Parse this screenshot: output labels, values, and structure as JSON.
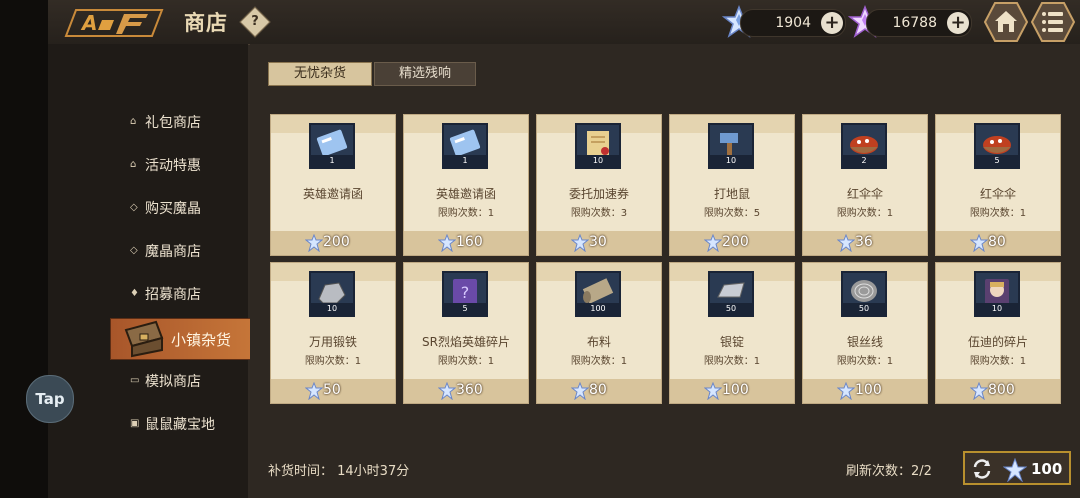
{
  "header": {
    "title": "商店",
    "help_label": "?",
    "currency_gem_value": "1904",
    "currency_crystal_value": "16788"
  },
  "subtabs": [
    "无忧杂货",
    "精选残响"
  ],
  "sidebar": {
    "items": [
      {
        "label": "礼包商店",
        "icon": "house-icon"
      },
      {
        "label": "活动特惠",
        "icon": "house-icon"
      },
      {
        "label": "购买魔晶",
        "icon": "diamond-icon"
      },
      {
        "label": "魔晶商店",
        "icon": "diamond-icon"
      },
      {
        "label": "招募商店",
        "icon": "bell-icon"
      },
      {
        "label": "小镇杂货",
        "icon": "chest-icon"
      },
      {
        "label": "模拟商店",
        "icon": "monitor-icon"
      },
      {
        "label": "鼠鼠藏宝地",
        "icon": "box-icon"
      }
    ]
  },
  "tap_label": "Tap",
  "items": [
    {
      "name": "英雄邀请函",
      "qty": "1",
      "limit": "",
      "price": "200",
      "icon": "ticket-icon"
    },
    {
      "name": "英雄邀请函",
      "qty": "1",
      "limit": "限购次数：1",
      "price": "160",
      "icon": "ticket-icon"
    },
    {
      "name": "委托加速券",
      "qty": "10",
      "limit": "限购次数：3",
      "price": "30",
      "icon": "scroll-icon"
    },
    {
      "name": "打地鼠",
      "qty": "10",
      "limit": "限购次数：5",
      "price": "200",
      "icon": "hammer-icon"
    },
    {
      "name": "红伞伞",
      "qty": "2",
      "limit": "限购次数：1",
      "price": "36",
      "icon": "mushroom-bowl-icon"
    },
    {
      "name": "红伞伞",
      "qty": "5",
      "limit": "限购次数：1",
      "price": "80",
      "icon": "mushroom-bowl-icon"
    },
    {
      "name": "万用锻铁",
      "qty": "10",
      "limit": "限购次数：1",
      "price": "50",
      "icon": "ore-icon"
    },
    {
      "name": "SR烈焰英雄碎片",
      "qty": "5",
      "limit": "限购次数：1",
      "price": "360",
      "icon": "hero-shard-icon"
    },
    {
      "name": "布料",
      "qty": "100",
      "limit": "限购次数：1",
      "price": "80",
      "icon": "cloth-roll-icon"
    },
    {
      "name": "银锭",
      "qty": "50",
      "limit": "限购次数：1",
      "price": "100",
      "icon": "silver-ingot-icon"
    },
    {
      "name": "银丝线",
      "qty": "50",
      "limit": "限购次数：1",
      "price": "100",
      "icon": "silver-thread-icon"
    },
    {
      "name": "伍迪的碎片",
      "qty": "10",
      "limit": "限购次数：1",
      "price": "800",
      "icon": "portrait-shard-icon"
    }
  ],
  "footer": {
    "restock_text": "补货时间：  14小时37分",
    "refresh_count_text": "刷新次数：2/2",
    "refresh_cost": "100"
  },
  "colors": {
    "card_bg": "#efe5cc",
    "active_tab": "#c8783a",
    "gold_border": "#b8902e"
  }
}
